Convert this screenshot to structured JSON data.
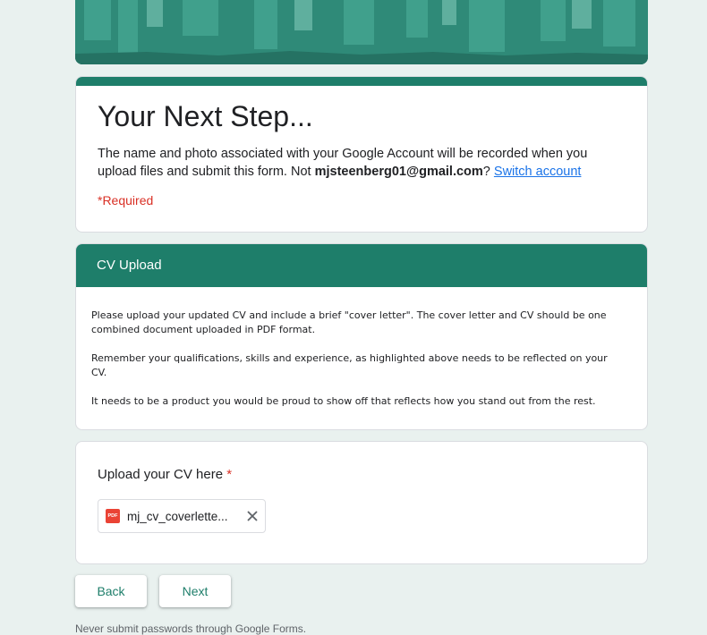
{
  "form": {
    "title": "Your Next Step...",
    "account_text_prefix": "The name and photo associated with your Google Account will be recorded when you upload files and submit this form. Not ",
    "account_email": "mjsteenberg01@gmail.com",
    "account_text_q": "?",
    "switch_account": "Switch account",
    "required_note": "*Required"
  },
  "section": {
    "title": "CV Upload",
    "paragraphs": [
      "Please upload your updated CV and include a brief \"cover letter\". The cover letter and CV should be one combined document uploaded in PDF format.",
      "Remember your qualifications, skills and experience, as highlighted above needs to be reflected on your CV.",
      "It needs to be a product you would be proud to show off that reflects how you stand out from the rest."
    ]
  },
  "question": {
    "title": "Upload your CV here",
    "required_star": "*",
    "file_icon_label": "PDF",
    "file_name": "mj_cv_coverlette..."
  },
  "nav": {
    "back": "Back",
    "next": "Next"
  },
  "footer": {
    "note": "Never submit passwords through Google Forms."
  },
  "colors": {
    "theme": "#1e7e6a",
    "background": "#e9f1ef",
    "required": "#d93025",
    "link": "#1a73e8"
  },
  "icons": {
    "file": "pdf-icon",
    "remove": "close-icon"
  }
}
